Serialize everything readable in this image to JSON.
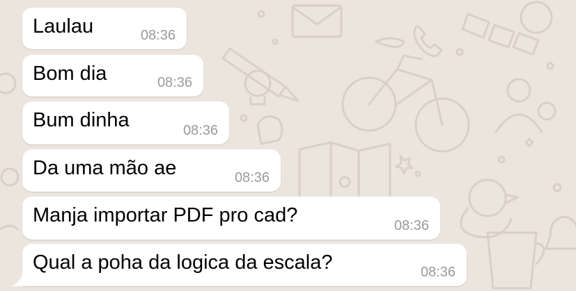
{
  "chat": {
    "background_color": "#ece5dd",
    "bubble_color": "#ffffff",
    "messages": [
      {
        "text": "Laulau",
        "time": "08:36"
      },
      {
        "text": "Bom dia",
        "time": "08:36"
      },
      {
        "text": "Bum dinha",
        "time": "08:36"
      },
      {
        "text": "Da uma mão ae",
        "time": "08:36"
      },
      {
        "text": "Manja importar PDF pro cad?",
        "time": "08:36"
      },
      {
        "text": "Qual a poha da logica da escala?",
        "time": "08:36"
      }
    ]
  }
}
